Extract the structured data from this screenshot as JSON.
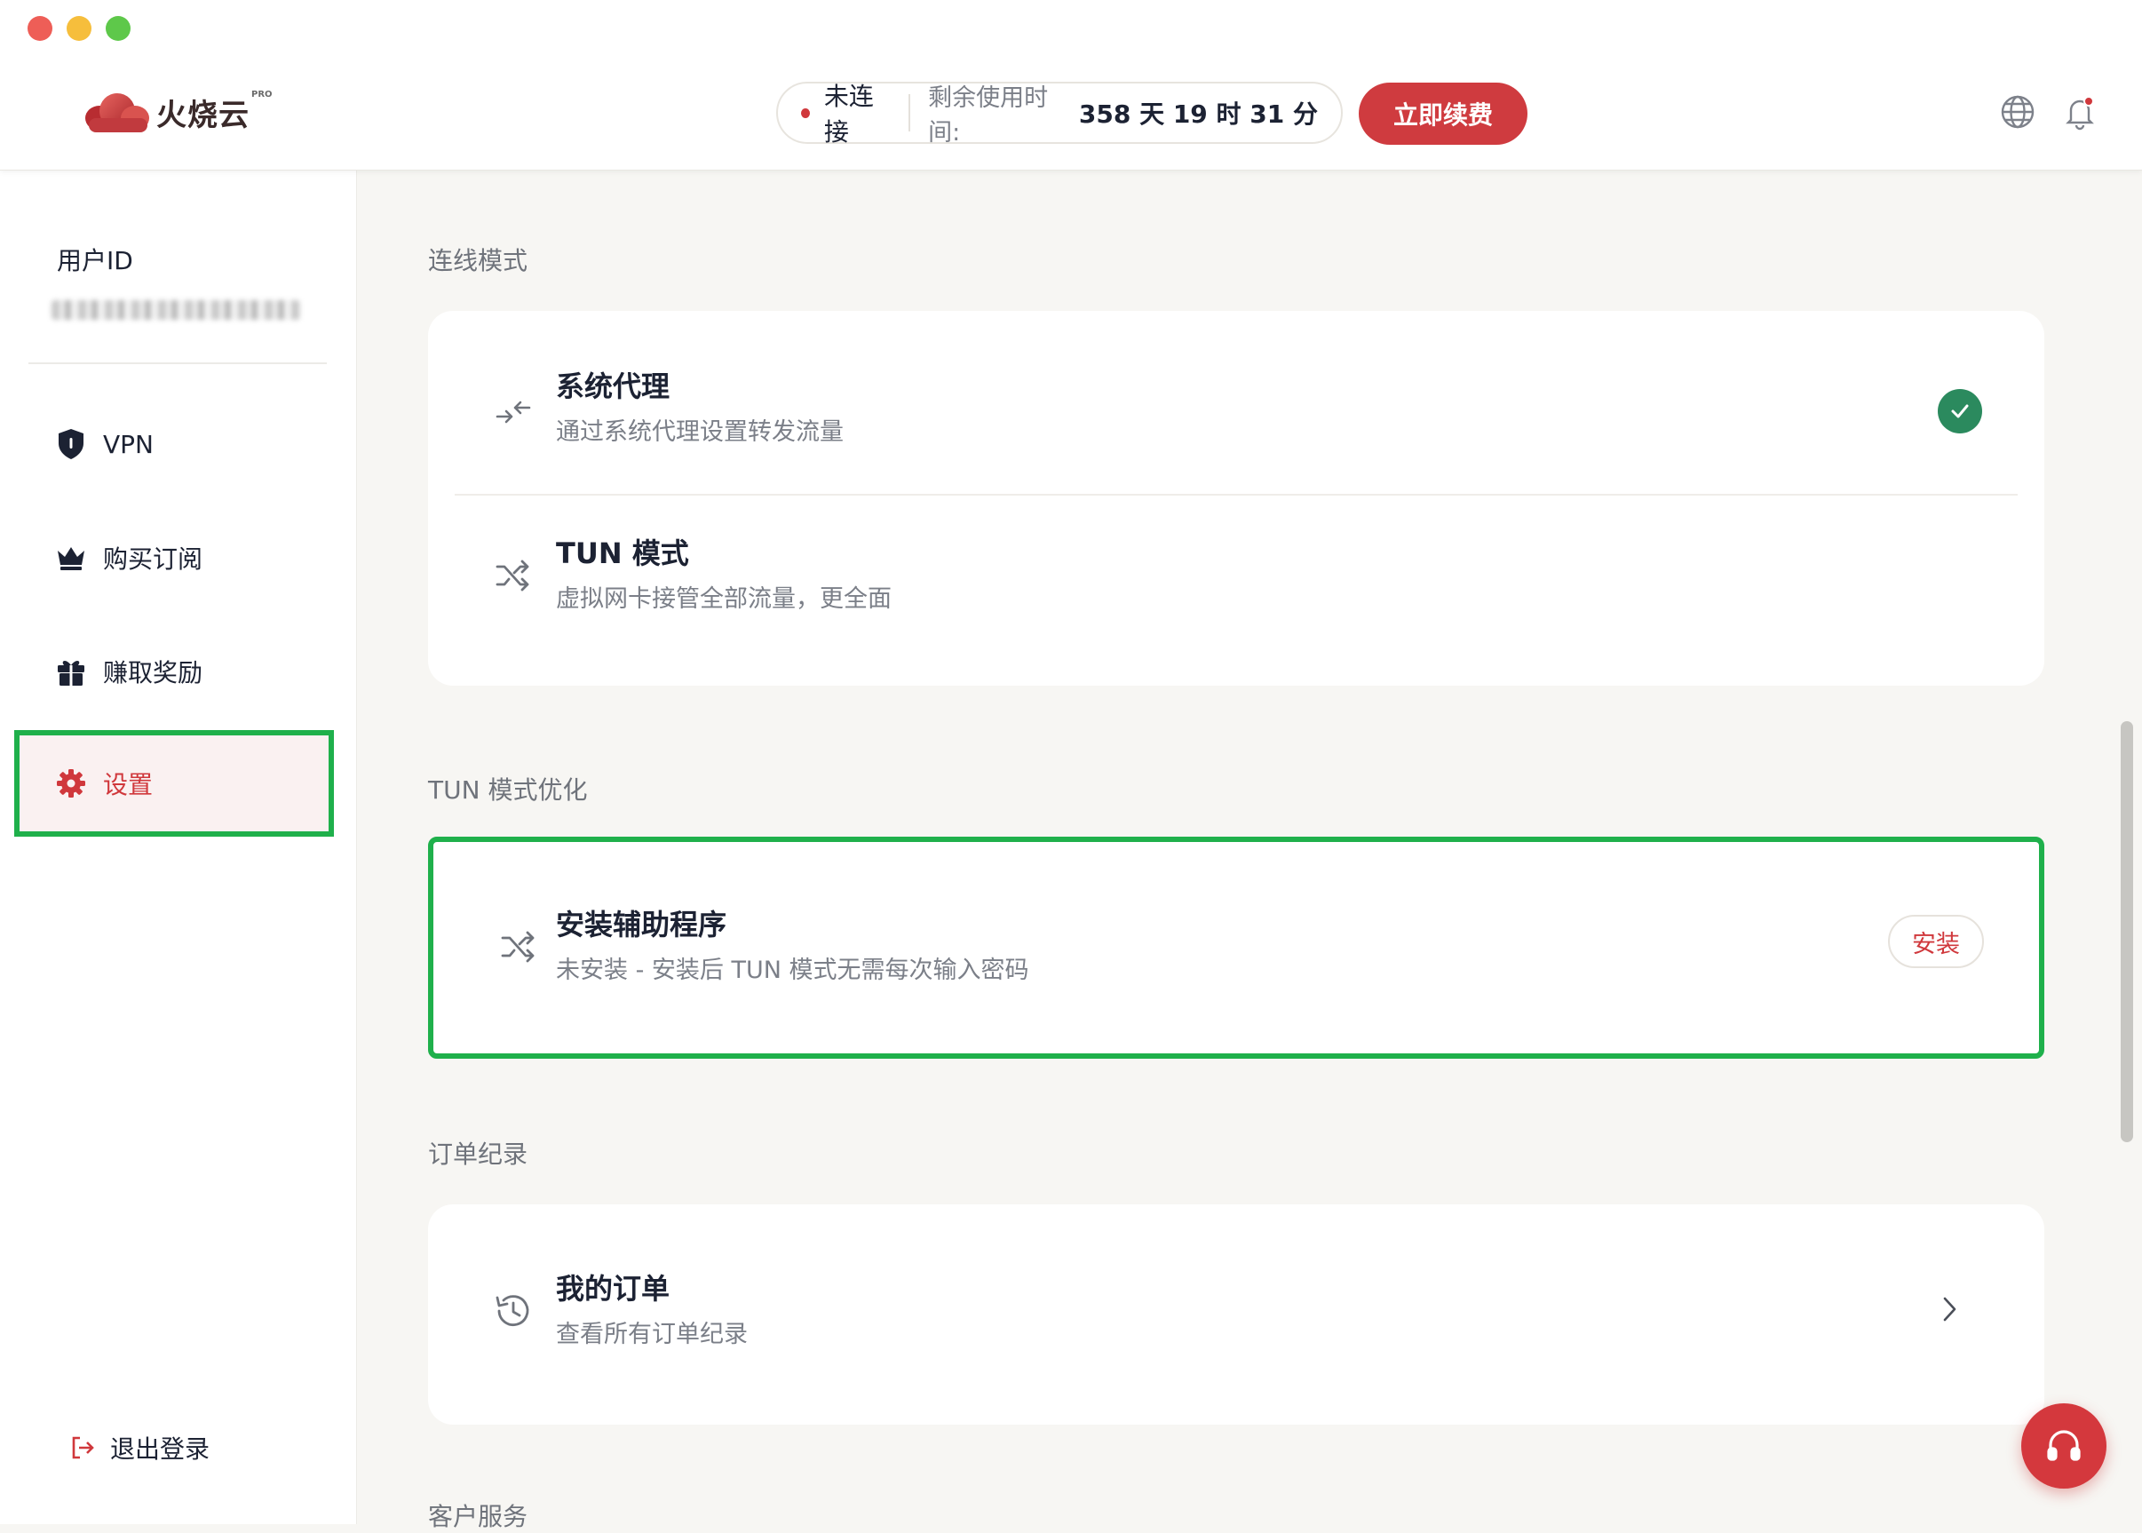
{
  "header": {
    "logo_text": "火烧云",
    "logo_badge": "PRO",
    "status_text": "未连接",
    "remaining_label": "剩余使用时间:",
    "remaining_value": "358 天 19 时 31 分",
    "renew_button": "立即续费",
    "icons": [
      "globe-icon",
      "bell-icon"
    ]
  },
  "sidebar": {
    "user_id_label": "用户ID",
    "nav": [
      {
        "label": "VPN",
        "icon": "shield-icon"
      },
      {
        "label": "购买订阅",
        "icon": "crown-icon"
      },
      {
        "label": "赚取奖励",
        "icon": "gift-icon"
      },
      {
        "label": "设置",
        "icon": "gear-icon",
        "active": true
      }
    ],
    "logout_label": "退出登录"
  },
  "main": {
    "connection_section": {
      "title": "连线模式",
      "options": [
        {
          "title": "系统代理",
          "desc": "通过系统代理设置转发流量",
          "selected": true
        },
        {
          "title": "TUN 模式",
          "desc": "虚拟网卡接管全部流量，更全面",
          "selected": false
        }
      ]
    },
    "tun_section": {
      "title": "TUN 模式优化",
      "helper_title": "安装辅助程序",
      "helper_desc": "未安装 - 安装后 TUN 模式无需每次输入密码",
      "install_button": "安装"
    },
    "orders_section": {
      "title": "订单纪录",
      "item_title": "我的订单",
      "item_desc": "查看所有订单纪录"
    },
    "support_section": {
      "title": "客户服务"
    }
  },
  "colors": {
    "accent_red": "#cf3b3f",
    "highlight_green": "#1fb04b",
    "check_green": "#2b8a5e",
    "background": "#f7f6f3"
  }
}
